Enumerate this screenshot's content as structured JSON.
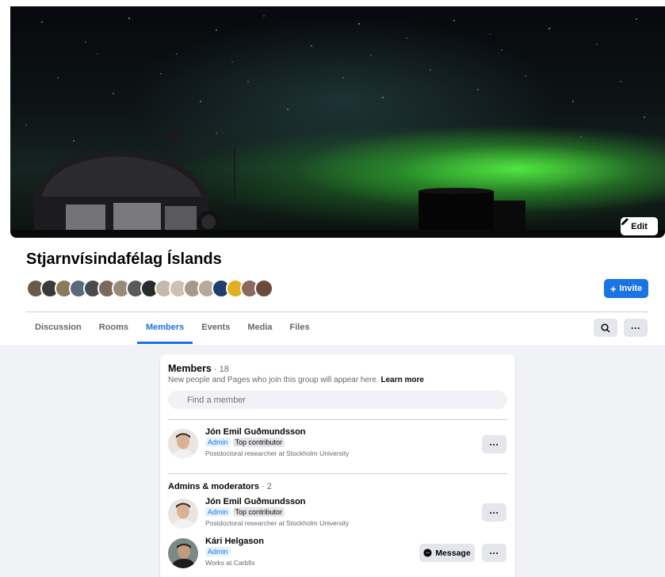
{
  "cover": {
    "edit_label": "Edit"
  },
  "group": {
    "title": "Stjarnvísindafélag Íslands",
    "invite_label": "Invite"
  },
  "avatar_colors": [
    "#6b5a4a",
    "#3a3a3a",
    "#8a7a5a",
    "#5a6a7a",
    "#4a4a4a",
    "#7a6a5a",
    "#9a8a7a",
    "#5a5a5a",
    "#2a2a2a",
    "#c8b8a8",
    "#d0c0b0",
    "#a89888",
    "#b8a898",
    "#1f3f6f",
    "#e0b020",
    "#8a6a5a",
    "#6a4a3a"
  ],
  "tabs": [
    "Discussion",
    "Rooms",
    "Members",
    "Events",
    "Media",
    "Files"
  ],
  "active_tab": "Members",
  "members": {
    "heading": "Members",
    "count": " · 18",
    "subtitle": "New people and Pages who join this group will appear here.",
    "learn_more": "Learn more",
    "search_placeholder": "Find a member",
    "featured": {
      "name": "Jón Emil Guðmundsson",
      "badge_admin": "Admin",
      "badge_top": "Top contributor",
      "description": "Postdoctoral researcher at Stockholm University"
    }
  },
  "admins": {
    "heading": "Admins & moderators",
    "count": " · 2",
    "list": [
      {
        "name": "Jón Emil Guðmundsson",
        "badge_admin": "Admin",
        "badge_top": "Top contributor",
        "description": "Postdoctoral researcher at Stockholm University"
      },
      {
        "name": "Kári Helgason",
        "badge_admin": "Admin",
        "description": "Works at Carbfix",
        "message_label": "Message"
      }
    ]
  },
  "more_label": "···"
}
